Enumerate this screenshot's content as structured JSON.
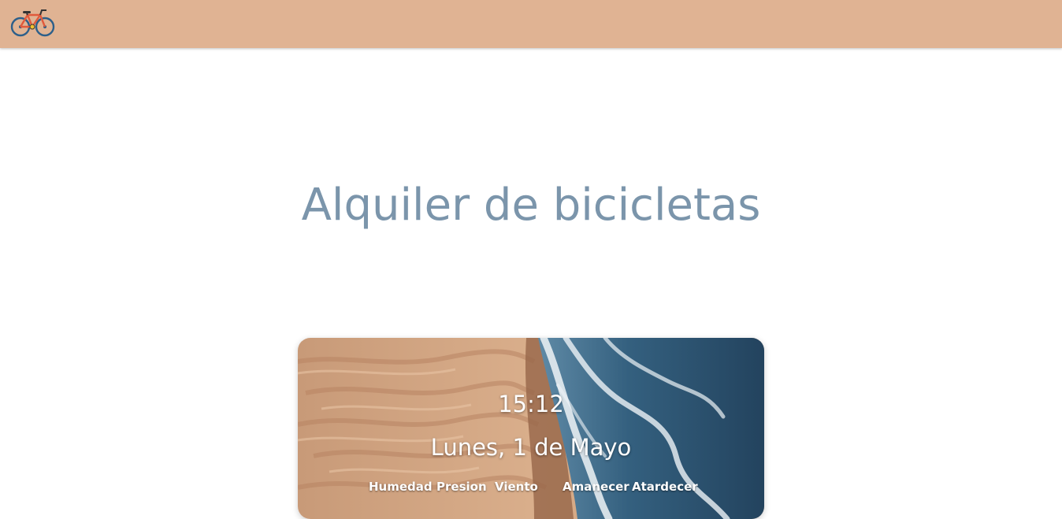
{
  "navbar": {
    "logo_icon": "bicycle-icon",
    "background": "#e0b393"
  },
  "main": {
    "title": "Alquiler de bicicletas"
  },
  "weather_card": {
    "time": "15:12",
    "date": "Lunes, 1 de Mayo",
    "labels": {
      "humidity": "Humedad",
      "pressure": "Presion",
      "wind": "Viento",
      "sunrise": "Amanecer",
      "sunset": "Atardecer"
    }
  },
  "colors": {
    "title": "#7b95ab",
    "navbar": "#e0b393"
  }
}
